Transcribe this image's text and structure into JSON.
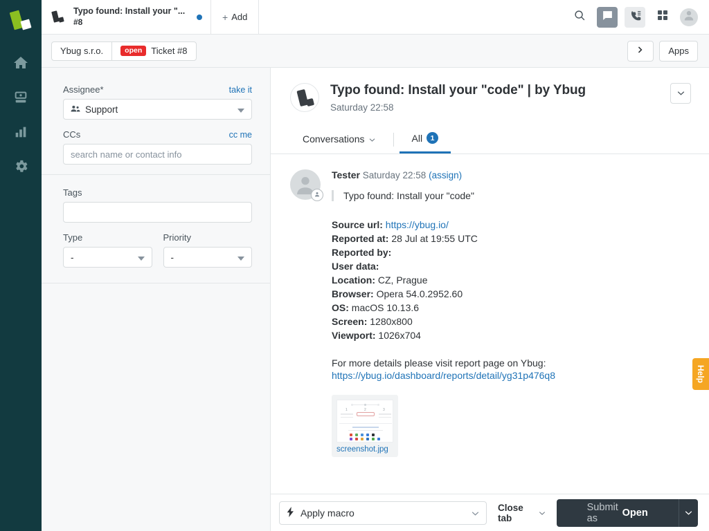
{
  "rail": {
    "logo_name": "ybug-logo",
    "items": [
      {
        "icon": "home-icon",
        "name": "home"
      },
      {
        "icon": "inbox-icon",
        "name": "views"
      },
      {
        "icon": "chart-icon",
        "name": "reporting"
      },
      {
        "icon": "gear-icon",
        "name": "admin"
      }
    ]
  },
  "topbar": {
    "tab": {
      "title": "Typo found: Install your \"...",
      "subtitle": "#8",
      "unread": true
    },
    "add_label": "Add",
    "add_plus": "+",
    "actions": [
      {
        "name": "search-icon"
      },
      {
        "name": "chat-offline-icon"
      },
      {
        "name": "talk-icon"
      },
      {
        "name": "apps-grid-icon"
      },
      {
        "name": "user-avatar-icon"
      }
    ]
  },
  "breadcrumb": {
    "organization": "Ybug s.r.o.",
    "status_pill": "open",
    "ticket": "Ticket #8",
    "next_label": "›",
    "apps_label": "Apps"
  },
  "panel": {
    "assignee": {
      "label": "Assignee*",
      "action": "take it",
      "value": "Support",
      "icon": "group-icon"
    },
    "ccs": {
      "label": "CCs",
      "action": "cc me",
      "placeholder": "search name or contact info",
      "value": ""
    },
    "tags": {
      "label": "Tags",
      "value": ""
    },
    "type": {
      "label": "Type",
      "value": "-"
    },
    "priority": {
      "label": "Priority",
      "value": "-"
    }
  },
  "conversation": {
    "title": "Typo found: Install your \"code\" | by Ybug",
    "timestamp": "Saturday 22:58",
    "tabs": [
      {
        "label": "Conversations",
        "has_caret": true,
        "active": false
      },
      {
        "label": "All",
        "badge": "1",
        "active": true
      }
    ],
    "message": {
      "author": "Tester",
      "time": "Saturday 22:58",
      "assign_link": "(assign)",
      "quote": "Typo found: Install your \"code\"",
      "fields": [
        {
          "key": "Source url:",
          "value": "https://ybug.io/",
          "is_link": true
        },
        {
          "key": "Reported at:",
          "value": "28 Jul at 19:55 UTC",
          "is_link": false
        },
        {
          "key": "Reported by:",
          "value": "",
          "is_link": false
        },
        {
          "key": "User data:",
          "value": "",
          "is_link": false
        },
        {
          "key": "Location:",
          "value": "CZ, Prague",
          "is_link": false
        },
        {
          "key": "Browser:",
          "value": "Opera 54.0.2952.60",
          "is_link": false
        },
        {
          "key": "OS:",
          "value": "macOS 10.13.6",
          "is_link": false
        },
        {
          "key": "Screen:",
          "value": "1280x800",
          "is_link": false
        },
        {
          "key": "Viewport:",
          "value": "1026x704",
          "is_link": false
        }
      ],
      "footer_text": "For more details please visit report page on Ybug:",
      "footer_link": "https://ybug.io/dashboard/reports/detail/yg31p476q8",
      "attachment": {
        "filename": "screenshot.jpg",
        "thumb_numbers": [
          "1",
          "2",
          "3"
        ]
      }
    }
  },
  "bottombar": {
    "macro_label": "Apply macro",
    "macro_icon": "bolt-icon",
    "close_tab_label": "Close tab",
    "submit_prefix": "Submit as",
    "submit_status": "Open"
  },
  "help_tab": {
    "label": "Help",
    "color": "#f5a623"
  }
}
